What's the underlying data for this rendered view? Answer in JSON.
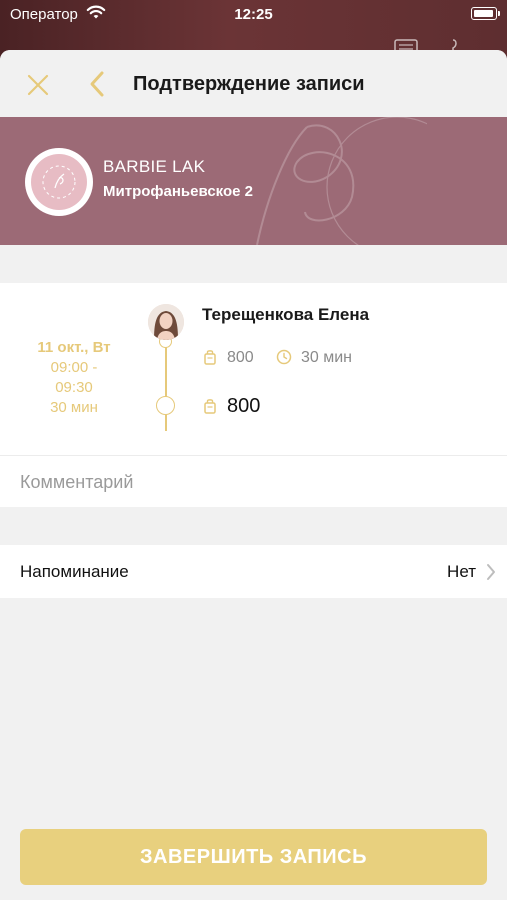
{
  "status_bar": {
    "carrier": "Оператор",
    "time": "12:25",
    "wifi_icon": "wifi-icon",
    "battery_icon": "battery-icon"
  },
  "nav": {
    "title": "Подтверждение записи",
    "close_icon": "close-icon",
    "back_icon": "chevron-left-icon"
  },
  "salon": {
    "name": "BARBIE LAK",
    "address": "Митрофаньевское 2",
    "banner_color": "#9c6a76"
  },
  "appointment": {
    "date": "11 окт., Вт",
    "time_start": "09:00 -",
    "time_end": "09:30",
    "duration": "30 мин",
    "master_name": "Терещенкова Елена",
    "service_price": "800",
    "service_duration": "30 мин",
    "total_price": "800"
  },
  "comment": {
    "placeholder": "Комментарий"
  },
  "reminder": {
    "label": "Напоминание",
    "value": "Нет"
  },
  "submit": {
    "label": "ЗАВЕРШИТЬ ЗАПИСЬ"
  },
  "colors": {
    "accent": "#e6c97a",
    "button": "#e8d07e",
    "background": "#f1f1f1"
  }
}
